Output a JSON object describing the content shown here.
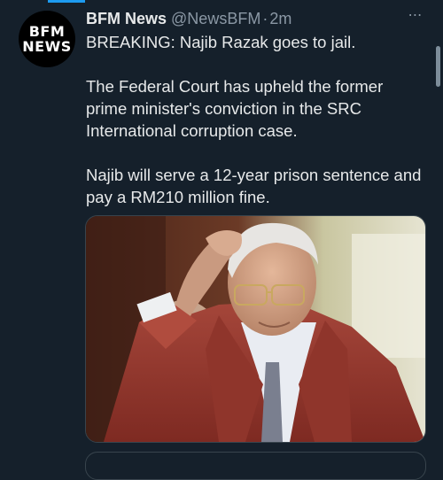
{
  "tweet": {
    "avatar_line1": "BFM",
    "avatar_line2": "NEWS",
    "display_name": "BFM News",
    "handle": "@NewsBFM",
    "separator": "·",
    "time": "2m",
    "more_icon": "⋯",
    "paragraphs": [
      "BREAKING: Najib Razak goes to jail.",
      "The Federal Court has upheld the former prime minister's conviction in the SRC International corruption case.",
      "Najib will serve a 12-year prison sentence and pay a RM210 million fine."
    ]
  },
  "colors": {
    "background": "#15202b",
    "text": "#e7e9ea",
    "secondary_text": "#8b98a5",
    "accent": "#1d9bf0",
    "border": "#38444d"
  }
}
